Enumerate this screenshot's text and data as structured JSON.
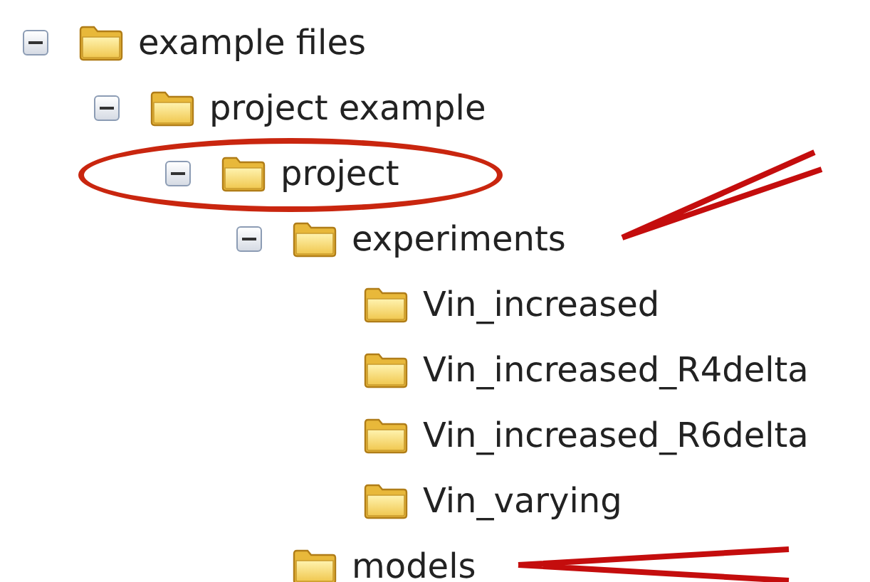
{
  "tree": [
    {
      "label": "example files",
      "expanded": true,
      "children": [
        {
          "label": "project example",
          "expanded": true,
          "children": [
            {
              "label": "project",
              "expanded": true,
              "highlighted": true,
              "children": [
                {
                  "label": "experiments",
                  "expanded": true,
                  "annotated": true,
                  "children": [
                    {
                      "label": "Vin_increased"
                    },
                    {
                      "label": "Vin_increased_R4delta"
                    },
                    {
                      "label": "Vin_increased_R6delta"
                    },
                    {
                      "label": "Vin_varying"
                    }
                  ]
                },
                {
                  "label": "models",
                  "annotated": true
                }
              ]
            }
          ]
        }
      ]
    }
  ]
}
